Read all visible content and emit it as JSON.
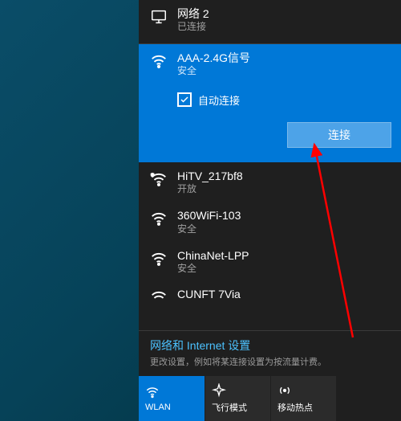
{
  "ethernet": {
    "name": "网络 2",
    "status": "已连接"
  },
  "selected": {
    "name": "AAA-2.4G信号",
    "status": "安全",
    "auto_connect_label": "自动连接",
    "connect_button": "连接"
  },
  "networks": [
    {
      "name": "HiTV_217bf8",
      "status": "开放",
      "secure_shield": true
    },
    {
      "name": "360WiFi-103",
      "status": "安全"
    },
    {
      "name": "ChinaNet-LPP",
      "status": "安全"
    },
    {
      "name": "CUNFT 7Via",
      "status": ""
    }
  ],
  "settings": {
    "title": "网络和 Internet 设置",
    "subtitle": "更改设置，例如将某连接设置为按流量计费。"
  },
  "tiles": {
    "wlan": "WLAN",
    "airplane": "飞行模式",
    "hotspot": "移动热点"
  }
}
